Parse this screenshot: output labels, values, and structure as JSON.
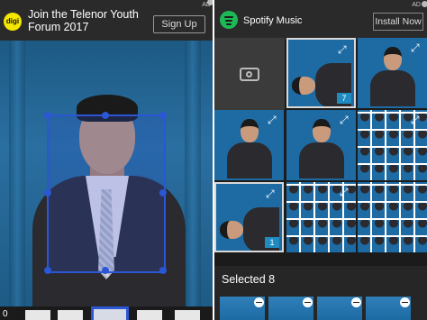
{
  "left_panel": {
    "ad": {
      "logo_text": "digi",
      "title": "Join the Telenor Youth Forum 2017",
      "cta": "Sign Up",
      "tag": "AD"
    },
    "corner_label": "0"
  },
  "right_panel": {
    "ad": {
      "title": "Spotify Music",
      "cta": "Install Now",
      "tag": "AD"
    },
    "grid": {
      "items": [
        {
          "type": "camera",
          "icon": "camera-icon"
        },
        {
          "type": "photo",
          "selected": true,
          "number": "7"
        },
        {
          "type": "photo",
          "selected": false
        },
        {
          "type": "photo",
          "selected": false
        },
        {
          "type": "photo",
          "selected": false
        },
        {
          "type": "tile",
          "selected": false
        },
        {
          "type": "photo",
          "selected": true,
          "number": "1"
        },
        {
          "type": "tile",
          "selected": false
        },
        {
          "type": "tile",
          "selected": false
        }
      ]
    },
    "selected_label": "Selected 8"
  },
  "colors": {
    "crop_frame": "#2b56d4",
    "ad_bg": "#2a2a2a",
    "spotify_green": "#1db954",
    "number_badge": "#1f8cc1"
  }
}
